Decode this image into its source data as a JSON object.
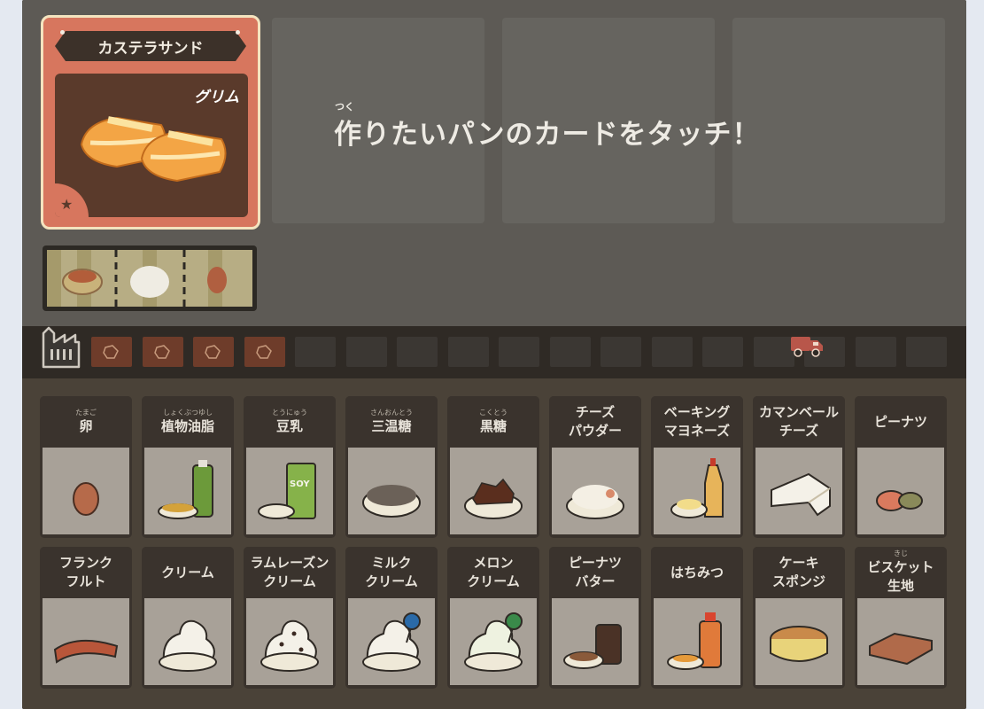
{
  "recipe": {
    "title": "カステラサンド",
    "brand": "グリム",
    "star_icon": "star-icon"
  },
  "instruction": {
    "ruby": "つく",
    "text": "作りたいパンのカードをタッチ！"
  },
  "progress": {
    "done_slots": 4,
    "total_slots": 17
  },
  "ingredients_row1": [
    {
      "furigana": "たまご",
      "label": "卵",
      "icon": "egg-icon"
    },
    {
      "furigana": "しょくぶつゆし",
      "label": "植物油脂",
      "icon": "vegetable-oil-icon"
    },
    {
      "furigana": "とうにゅう",
      "label": "豆乳",
      "icon": "soy-milk-icon"
    },
    {
      "furigana": "さんおんとう",
      "label": "三温糖",
      "icon": "brown-sugar-icon"
    },
    {
      "furigana": "こくとう",
      "label": "黒糖",
      "icon": "black-sugar-icon"
    },
    {
      "furigana": "",
      "label": "チーズ\nパウダー",
      "icon": "cheese-powder-icon"
    },
    {
      "furigana": "",
      "label": "ベーキング\nマヨネーズ",
      "icon": "mayonnaise-icon"
    },
    {
      "furigana": "",
      "label": "カマンベール\nチーズ",
      "icon": "camembert-icon"
    },
    {
      "furigana": "",
      "label": "ピーナツ",
      "icon": "peanut-icon"
    }
  ],
  "ingredients_row2": [
    {
      "furigana": "",
      "label": "フランク\nフルト",
      "icon": "frankfurter-icon"
    },
    {
      "furigana": "",
      "label": "クリーム",
      "icon": "cream-icon"
    },
    {
      "furigana": "",
      "label": "ラムレーズン\nクリーム",
      "icon": "rum-raisin-cream-icon"
    },
    {
      "furigana": "",
      "label": "ミルク\nクリーム",
      "icon": "milk-cream-icon"
    },
    {
      "furigana": "",
      "label": "メロン\nクリーム",
      "icon": "melon-cream-icon"
    },
    {
      "furigana": "",
      "label": "ピーナツ\nバター",
      "icon": "peanut-butter-icon"
    },
    {
      "furigana": "",
      "label": "はちみつ",
      "icon": "honey-icon"
    },
    {
      "furigana": "",
      "label": "ケーキ\nスポンジ",
      "icon": "cake-sponge-icon"
    },
    {
      "furigana": "きじ",
      "label": "ビスケット\n生地",
      "icon": "biscuit-dough-icon"
    }
  ]
}
